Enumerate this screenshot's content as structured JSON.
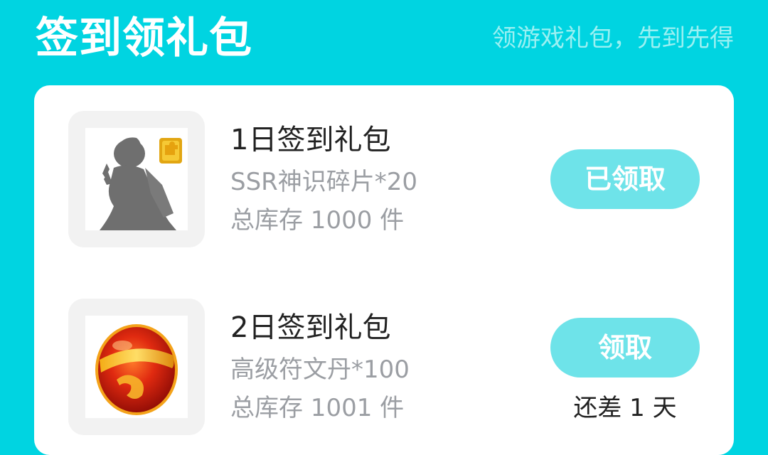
{
  "header": {
    "title": "签到领礼包",
    "subtitle": "领游戏礼包，先到先得"
  },
  "gifts": [
    {
      "title": "1日签到礼包",
      "desc": "SSR神识碎片*20",
      "stock": "总库存 1000 件",
      "button_label": "已领取",
      "icon": "character-silhouette-icon"
    },
    {
      "title": "2日签到礼包",
      "desc": "高级符文丹*100",
      "stock": "总库存 1001 件",
      "button_label": "领取",
      "remaining": "还差 1 天",
      "icon": "red-rune-pill-icon"
    }
  ],
  "colors": {
    "background": "#00d4e1",
    "button": "#6ee3e9",
    "card": "#ffffff"
  }
}
